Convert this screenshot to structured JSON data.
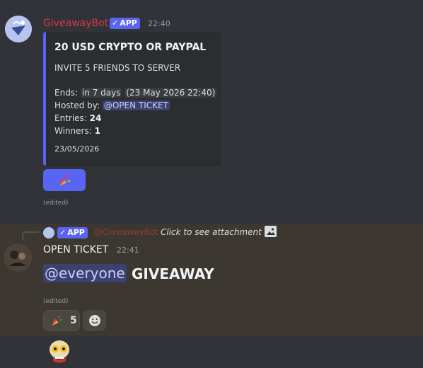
{
  "message1": {
    "author": "GiveawayBot",
    "app_badge": "APP",
    "timestamp": "22:40",
    "embed": {
      "title": "20 USD CRYPTO OR PAYPAL",
      "description": "INVITE 5 FRIENDS TO SERVER",
      "ends_label": "Ends:",
      "ends_relative": "in 7 days",
      "ends_absolute": "23 May 2026 22:40",
      "hosted_label": "Hosted by:",
      "hosted_mention": "@OPEN TICKET",
      "entries_label": "Entries:",
      "entries_value": "24",
      "winners_label": "Winners:",
      "winners_value": "1",
      "footer": "23/05/2026"
    },
    "button_icon": "party-popper-icon",
    "edited": "(edited)"
  },
  "message2": {
    "reply": {
      "app_badge": "APP",
      "author": "@GiveawayBot",
      "text": "Click to see attachment"
    },
    "author": "OPEN TICKET",
    "timestamp": "22:41",
    "mention": "@everyone",
    "content": "GIVEAWAY",
    "edited": "(edited)",
    "reaction": {
      "emoji": "party-popper-icon",
      "count": "5"
    },
    "add_reaction_icon": "smiley-icon"
  },
  "colors": {
    "background": "#313338",
    "highlight": "#3c3831",
    "blurple": "#5865f2",
    "bot_name": "#d83a42"
  }
}
